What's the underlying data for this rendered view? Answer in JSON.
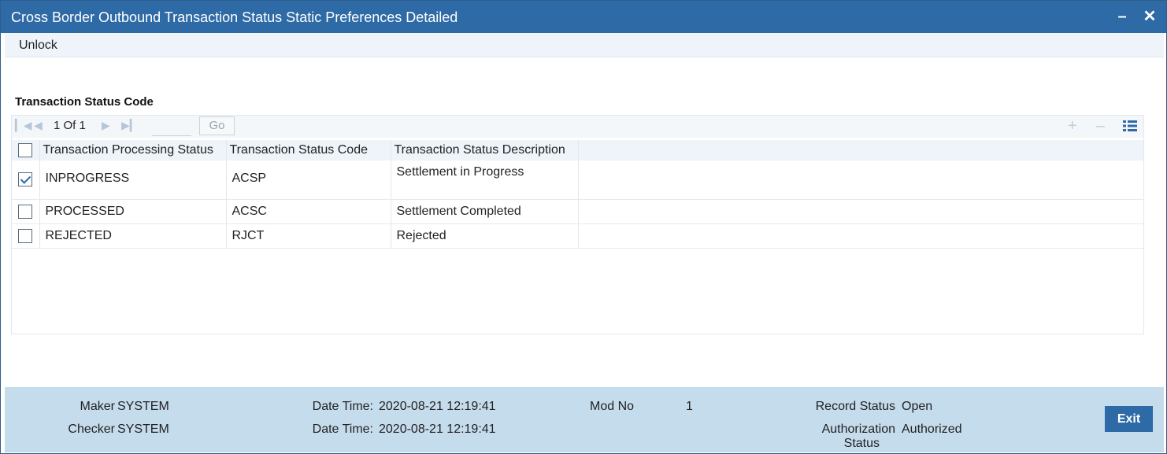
{
  "window": {
    "title": "Cross Border Outbound Transaction Status Static Preferences Detailed",
    "minimize_icon": "minimize-icon",
    "close_icon": "close-icon"
  },
  "menu": {
    "unlock_label": "Unlock"
  },
  "section": {
    "title": "Transaction Status Code"
  },
  "pager": {
    "page_info": "1 Of 1",
    "go_label": "Go",
    "page_input_value": "",
    "icons": [
      "first-page-icon",
      "prev-page-icon",
      "next-page-icon",
      "last-page-icon",
      "add-row-icon",
      "delete-row-icon",
      "columns-icon"
    ]
  },
  "grid": {
    "columns": [
      "Transaction Processing Status",
      "Transaction Status Code",
      "Transaction Status Description"
    ],
    "rows": [
      {
        "checked": true,
        "status": "INPROGRESS",
        "code": "ACSP",
        "description": "Settlement in Progress"
      },
      {
        "checked": false,
        "status": "PROCESSED",
        "code": "ACSC",
        "description": "Settlement Completed"
      },
      {
        "checked": false,
        "status": "REJECTED",
        "code": "RJCT",
        "description": "Rejected"
      }
    ]
  },
  "footer": {
    "maker_label": "Maker",
    "maker_value": "SYSTEM",
    "checker_label": "Checker",
    "checker_value": "SYSTEM",
    "maker_datetime_label": "Date Time:",
    "maker_datetime_value": "2020-08-21 12:19:41",
    "checker_datetime_label": "Date Time:",
    "checker_datetime_value": "2020-08-21 12:19:41",
    "mod_no_label": "Mod No",
    "mod_no_value": "1",
    "record_status_label": "Record Status",
    "record_status_value": "Open",
    "auth_status_label_1": "Authorization",
    "auth_status_label_2": "Status",
    "auth_status_value": "Authorized",
    "exit_label": "Exit"
  },
  "colors": {
    "titlebar": "#2e6aa6",
    "footer": "#c5dced",
    "header_row": "#eef4fa"
  }
}
